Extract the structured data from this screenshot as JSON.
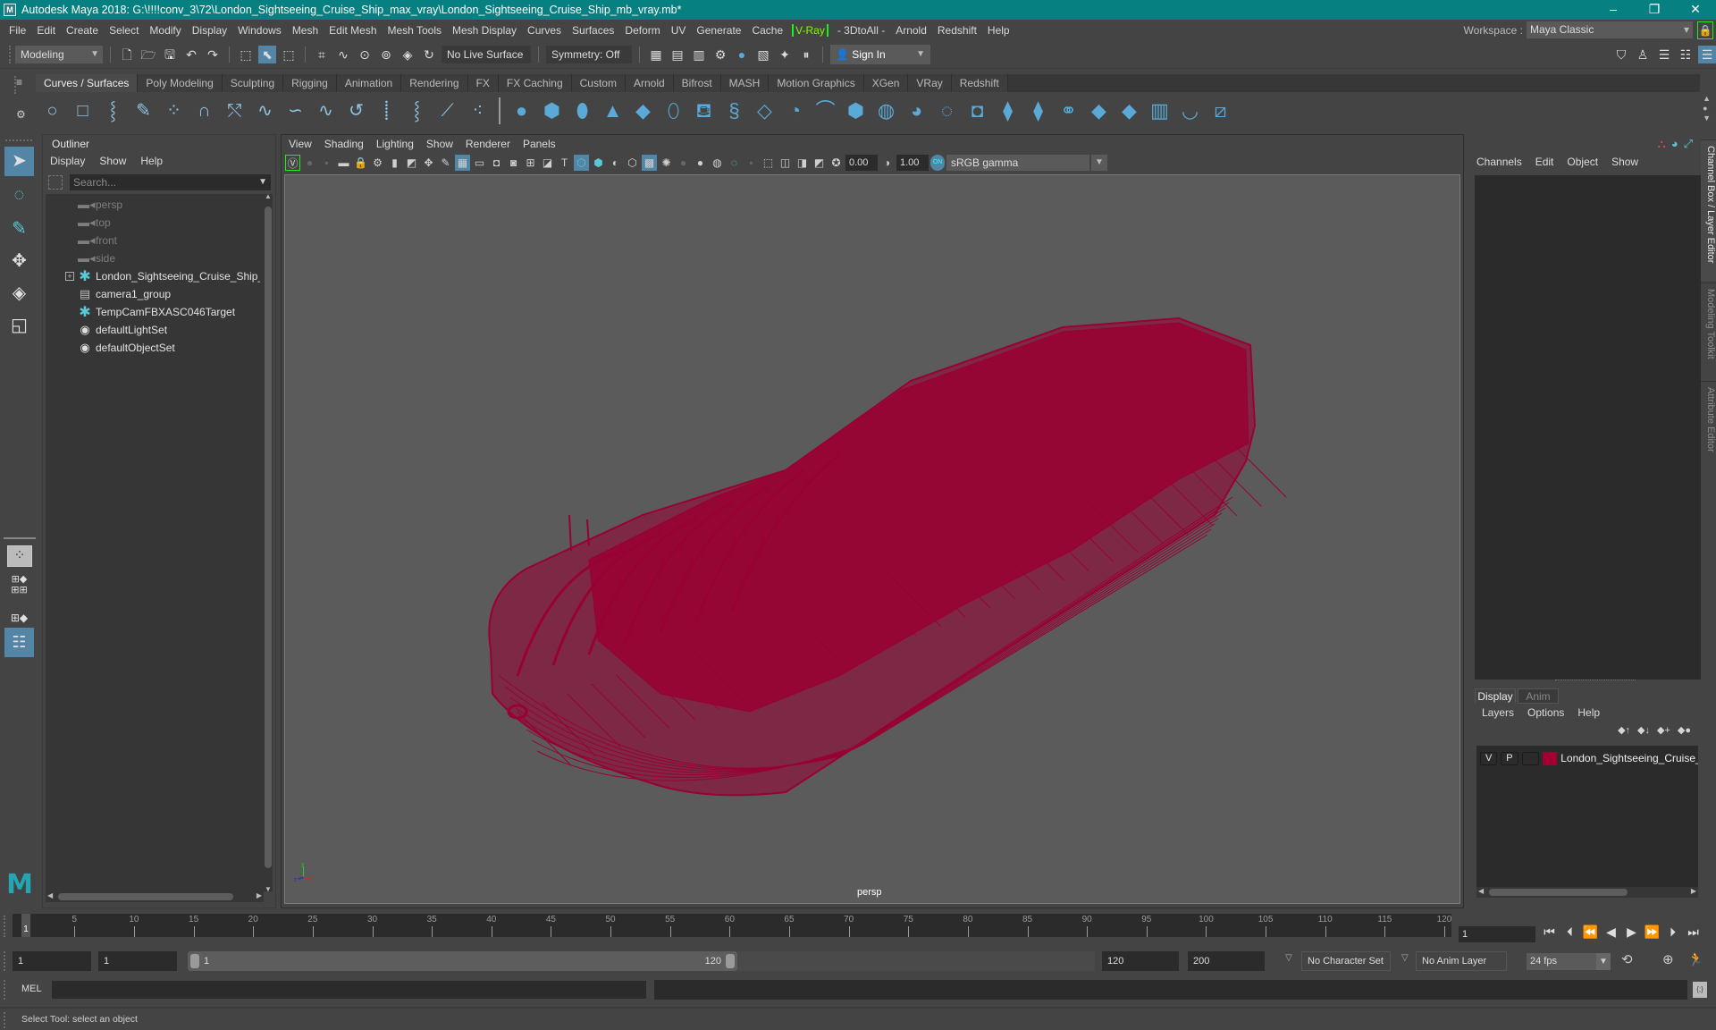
{
  "window": {
    "title": "Autodesk Maya 2018: G:\\!!!!conv_3\\72\\London_Sightseeing_Cruise_Ship_max_vray\\London_Sightseeing_Cruise_Ship_mb_vray.mb*",
    "logo": "M",
    "controls": {
      "minimize": "–",
      "maximize": "❐",
      "close": "✕"
    }
  },
  "menubar": {
    "items": [
      "File",
      "Edit",
      "Create",
      "Select",
      "Modify",
      "Display",
      "Windows",
      "Mesh",
      "Edit Mesh",
      "Mesh Tools",
      "Mesh Display",
      "Curves",
      "Surfaces",
      "Deform",
      "UV",
      "Generate",
      "Cache"
    ],
    "vray": "V-Ray",
    "items_after": [
      "- 3DtoAll -",
      "Arnold",
      "Redshift",
      "Help"
    ],
    "workspace_label": "Workspace :",
    "workspace_value": "Maya Classic",
    "lock_icon": "lock-icon"
  },
  "statusline": {
    "mode": "Modeling",
    "live_surface": "No Live Surface",
    "symmetry": "Symmetry: Off",
    "sign_in": "Sign In"
  },
  "shelf": {
    "tabs": [
      "Curves / Surfaces",
      "Poly Modeling",
      "Sculpting",
      "Rigging",
      "Animation",
      "Rendering",
      "FX",
      "FX Caching",
      "Custom",
      "Arnold",
      "Bifrost",
      "MASH",
      "Motion Graphics",
      "XGen",
      "VRay",
      "Redshift"
    ],
    "active_tab": "Curves / Surfaces",
    "curve_tools": [
      "nurbs-circle",
      "nurbs-square",
      "cv-curve",
      "pencil-curve",
      "ep-curve",
      "arc-three-point",
      "bezier-curve",
      "attach-curves",
      "detach-curves",
      "insert-knot",
      "extend-curve",
      "offset-curve",
      "rebuild-curve",
      "reverse-curve",
      "project-curve"
    ],
    "surface_tools": [
      "nurbs-sphere",
      "nurbs-cube",
      "nurbs-cylinder",
      "nurbs-cone",
      "nurbs-plane",
      "nurbs-torus",
      "revolve",
      "loft",
      "planar",
      "extrude",
      "birail",
      "bevel-plus",
      "boundary",
      "square-surface",
      "trim-tool",
      "untrim",
      "project-on-surface",
      "intersect",
      "attach-surfaces",
      "detach-surfaces",
      "rebuild-surface",
      "insert-isoparm",
      "align-surfaces",
      "sculpt-geometry",
      "open-close"
    ]
  },
  "outliner": {
    "title": "Outliner",
    "menus": [
      "Display",
      "Show",
      "Help"
    ],
    "search_placeholder": "Search...",
    "items": [
      {
        "label": "persp",
        "icon": "camera-icon",
        "dim": true,
        "expandable": false
      },
      {
        "label": "top",
        "icon": "camera-icon",
        "dim": true,
        "expandable": false
      },
      {
        "label": "front",
        "icon": "camera-icon",
        "dim": true,
        "expandable": false
      },
      {
        "label": "side",
        "icon": "camera-icon",
        "dim": true,
        "expandable": false
      },
      {
        "label": "London_Sightseeing_Cruise_Ship_ncl",
        "icon": "transform-star-icon",
        "dim": false,
        "expandable": true
      },
      {
        "label": "camera1_group",
        "icon": "group-icon",
        "dim": false,
        "expandable": false
      },
      {
        "label": "TempCamFBXASC046Target",
        "icon": "transform-star-icon",
        "dim": false,
        "expandable": false
      },
      {
        "label": "defaultLightSet",
        "icon": "set-icon",
        "dim": false,
        "expandable": false
      },
      {
        "label": "defaultObjectSet",
        "icon": "set-icon",
        "dim": false,
        "expandable": false
      }
    ]
  },
  "viewport": {
    "menus": [
      "View",
      "Shading",
      "Lighting",
      "Show",
      "Renderer",
      "Panels"
    ],
    "exposure": "0.00",
    "gamma": "1.00",
    "color_management": "ON",
    "color_space": "sRGB gamma",
    "camera": "persp",
    "axis": {
      "x": "x",
      "y": "y",
      "z": "z"
    },
    "wireframe_color": "#990033",
    "background_color": "#5b5b5b"
  },
  "channelbox": {
    "menus": [
      "Channels",
      "Edit",
      "Object",
      "Show"
    ]
  },
  "layereditor": {
    "tabs": [
      "Display",
      "Anim"
    ],
    "active_tab": "Display",
    "menus": [
      "Layers",
      "Options",
      "Help"
    ],
    "layers": [
      {
        "visible": "V",
        "playback": "P",
        "name": "London_Sightseeing_Cruise_S",
        "color": "#a10030"
      }
    ]
  },
  "side_tabs": [
    "Channel Box / Layer Editor",
    "Modeling Toolkit",
    "Attribute Editor"
  ],
  "timeslider": {
    "current_frame": "1",
    "ticks": [
      5,
      10,
      15,
      20,
      25,
      30,
      35,
      40,
      45,
      50,
      55,
      60,
      65,
      70,
      75,
      80,
      85,
      90,
      95,
      100,
      105,
      110,
      115,
      120
    ],
    "range_min": 1,
    "range_max": 120,
    "current_frame_field": "1"
  },
  "rangebar": {
    "start_time": "1",
    "playback_start": "1",
    "slider_start": "1",
    "slider_end": "120",
    "playback_end": "120",
    "end_time": "200",
    "character_set": "No Character Set",
    "anim_layer": "No Anim Layer",
    "fps": "24 fps"
  },
  "commandline": {
    "label": "MEL"
  },
  "helpline": {
    "text": "Select Tool: select an object"
  }
}
